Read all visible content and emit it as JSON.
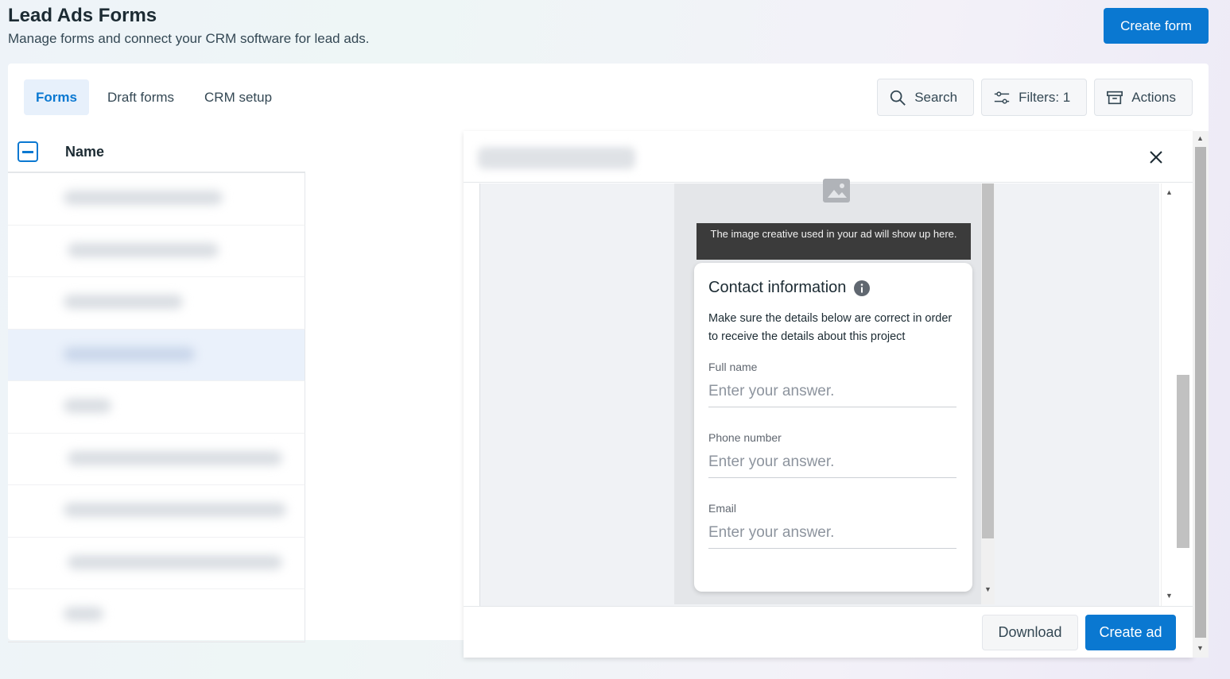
{
  "header": {
    "title": "Lead Ads Forms",
    "subtitle": "Manage forms and connect your CRM software for lead ads.",
    "create_form_label": "Create form"
  },
  "tabs": [
    {
      "label": "Forms",
      "active": true
    },
    {
      "label": "Draft forms",
      "active": false
    },
    {
      "label": "CRM setup",
      "active": false
    }
  ],
  "toolbar": {
    "search_label": "Search",
    "filters_label": "Filters: 1",
    "actions_label": "Actions"
  },
  "table": {
    "column_name": "Name"
  },
  "preview": {
    "tooltip": "The image creative used in your ad will show up here.",
    "card_title": "Contact information",
    "card_description": "Make sure the details below are correct in order to receive the details about this project",
    "fields": [
      {
        "label": "Full name",
        "placeholder": "Enter your answer."
      },
      {
        "label": "Phone number",
        "placeholder": "Enter your answer."
      },
      {
        "label": "Email",
        "placeholder": "Enter your answer."
      }
    ]
  },
  "footer": {
    "download_label": "Download",
    "create_ad_label": "Create ad"
  },
  "colors": {
    "primary": "#0a78d1",
    "tab_active_bg": "#e7f0fb"
  }
}
